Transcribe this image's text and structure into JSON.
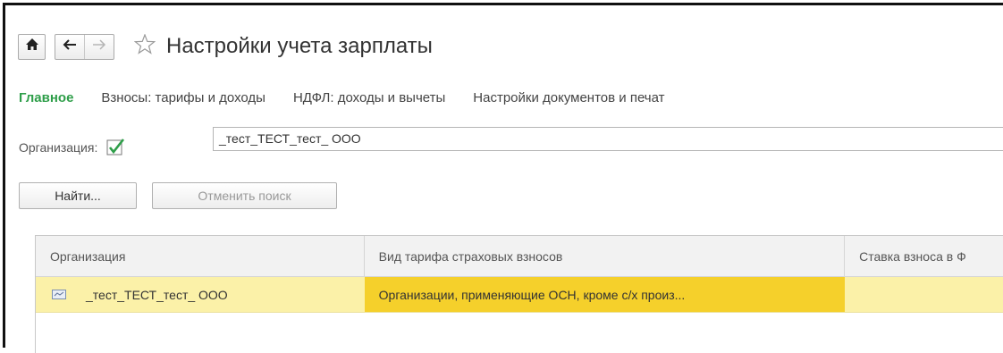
{
  "header": {
    "title": "Настройки учета зарплаты",
    "home_icon": "home-icon",
    "back_icon": "arrow-left-icon",
    "forward_icon": "arrow-right-icon",
    "favorite_icon": "star-icon"
  },
  "tabs": [
    {
      "label": "Главное",
      "active": true
    },
    {
      "label": "Взносы: тарифы и доходы",
      "active": false
    },
    {
      "label": "НДФЛ: доходы и вычеты",
      "active": false
    },
    {
      "label": "Настройки документов и печат",
      "active": false
    }
  ],
  "filter": {
    "label": "Организация:",
    "checked": true,
    "value": "_тест_ТЕСТ_тест_ ООО"
  },
  "buttons": {
    "find": "Найти...",
    "cancel_search": "Отменить поиск"
  },
  "table": {
    "columns": [
      "Организация",
      "Вид тарифа страховых взносов",
      "Ставка взноса в Ф"
    ],
    "rows": [
      {
        "org": "_тест_ТЕСТ_тест_ ООО",
        "tariff": "Организации, применяющие ОСН, кроме с/х произ...",
        "rate": ""
      }
    ]
  },
  "colors": {
    "active_tab": "#2e9e49",
    "selected_row": "#fbf1a8",
    "current_cell": "#f5d02b"
  }
}
